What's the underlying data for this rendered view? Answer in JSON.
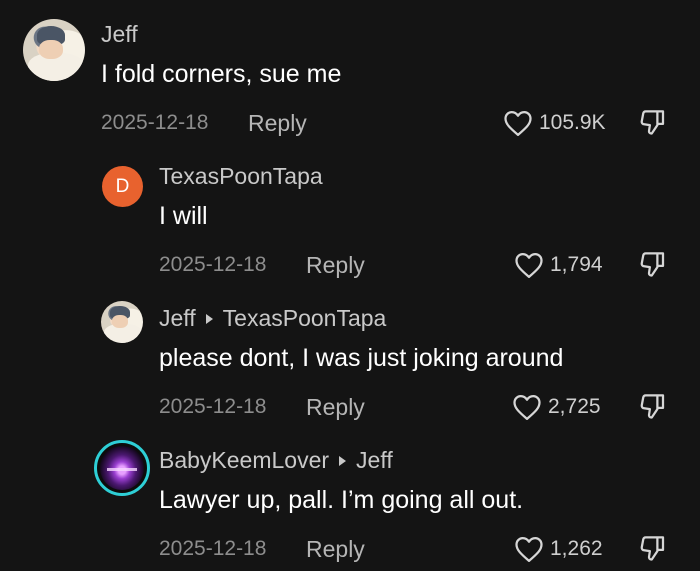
{
  "comments": [
    {
      "author": "Jeff",
      "reply_to": "",
      "text": "I fold corners, sue me",
      "date": "2025-12-18",
      "reply_label": "Reply",
      "likes": "105.9K",
      "avatar": "baby-photo"
    },
    {
      "author": "TexasPoonTapa",
      "reply_to": "",
      "text": "I will",
      "date": "2025-12-18",
      "reply_label": "Reply",
      "likes": "1,794",
      "avatar": "letter",
      "avatar_letter": "D",
      "avatar_color": "#e8622e"
    },
    {
      "author": "Jeff",
      "reply_to": "TexasPoonTapa",
      "text": "please dont, I was just joking around",
      "date": "2025-12-18",
      "reply_label": "Reply",
      "likes": "2,725",
      "avatar": "baby-photo"
    },
    {
      "author": "BabyKeemLover",
      "reply_to": "Jeff",
      "text": "Lawyer up, pall. I’m going all out.",
      "date": "2025-12-18",
      "reply_label": "Reply",
      "likes": "1,262",
      "avatar": "concert-photo",
      "avatar_ring_color": "#2ecfd6"
    }
  ],
  "icons": {
    "like": "heart-outline-icon",
    "dislike": "thumbs-down-icon"
  }
}
